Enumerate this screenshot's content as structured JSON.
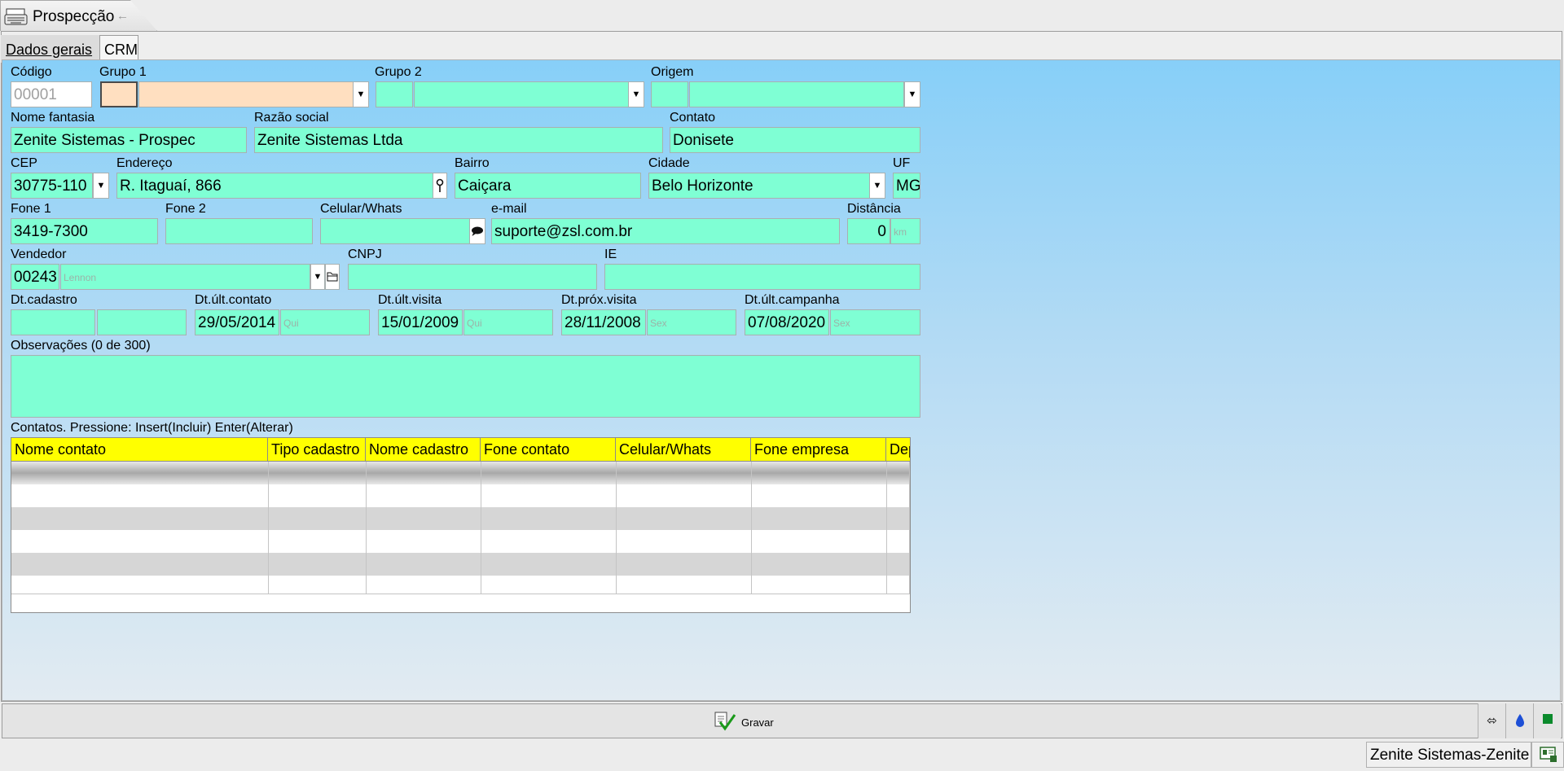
{
  "window": {
    "title": "Prospecção",
    "back_glyph": "←"
  },
  "tabs": {
    "dados_gerais": "Dados gerais",
    "crm": "CRM"
  },
  "form": {
    "codigo": {
      "label": "Código",
      "value": "00001"
    },
    "grupo1": {
      "label": "Grupo 1",
      "code": "",
      "name": ""
    },
    "grupo2": {
      "label": "Grupo 2",
      "code": "",
      "name": ""
    },
    "origem": {
      "label": "Origem",
      "code": "",
      "name": ""
    },
    "nome_fantasia": {
      "label": "Nome fantasia",
      "value": "Zenite Sistemas - Prospec"
    },
    "razao_social": {
      "label": "Razão social",
      "value": "Zenite Sistemas Ltda"
    },
    "contato": {
      "label": "Contato",
      "value": "Donisete"
    },
    "cep": {
      "label": "CEP",
      "value": "30775-110"
    },
    "endereco": {
      "label": "Endereço",
      "value": "R. Itaguaí, 866"
    },
    "bairro": {
      "label": "Bairro",
      "value": "Caiçara"
    },
    "cidade": {
      "label": "Cidade",
      "value": "Belo Horizonte"
    },
    "uf": {
      "label": "UF",
      "value": "MG"
    },
    "fone1": {
      "label": "Fone 1",
      "value": "3419-7300"
    },
    "fone2": {
      "label": "Fone 2",
      "value": ""
    },
    "celular": {
      "label": "Celular/Whats",
      "value": ""
    },
    "email": {
      "label": "e-mail",
      "value": "suporte@zsl.com.br"
    },
    "distancia": {
      "label": "Distância",
      "value": "0",
      "unit": "km"
    },
    "vendedor": {
      "label": "Vendedor",
      "code": "00243",
      "name": "Lennon"
    },
    "cnpj": {
      "label": "CNPJ",
      "value": ""
    },
    "ie": {
      "label": "IE",
      "value": ""
    },
    "dt_cadastro": {
      "label": "Dt.cadastro",
      "date": "",
      "weekday": ""
    },
    "dt_ult_contato": {
      "label": "Dt.últ.contato",
      "date": "29/05/2014",
      "weekday": "Qui"
    },
    "dt_ult_visita": {
      "label": "Dt.últ.visita",
      "date": "15/01/2009",
      "weekday": "Qui"
    },
    "dt_prox_visita": {
      "label": "Dt.próx.visita",
      "date": "28/11/2008",
      "weekday": "Sex"
    },
    "dt_ult_campanha": {
      "label": "Dt.últ.campanha",
      "date": "07/08/2020",
      "weekday": "Sex"
    },
    "observacoes": {
      "label": "Observações (0 de 300)",
      "value": ""
    }
  },
  "contatos": {
    "label": "Contatos.  Pressione: Insert(Incluir) Enter(Alterar)",
    "columns": [
      "Nome contato",
      "Tipo cadastro",
      "Nome cadastro",
      "Fone contato",
      "Celular/Whats",
      "Fone empresa",
      "Dep"
    ],
    "rows": []
  },
  "toolbar": {
    "save_label": "Gravar"
  },
  "status": {
    "user": "Zenite Sistemas-Zenite"
  },
  "colors": {
    "field_bg": "#7fffd4",
    "focus_bg": "#ffdfc0",
    "grid_header": "#ffff00",
    "panel_top": "#87cff8"
  }
}
